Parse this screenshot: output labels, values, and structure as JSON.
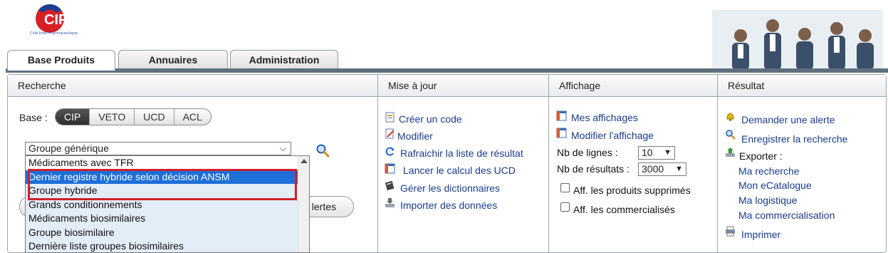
{
  "header": {
    "logo_text": "CIP",
    "logo_subtitle": "Club Inter Pharmaceutique"
  },
  "tabs": [
    {
      "label": "Base Produits",
      "active": true
    },
    {
      "label": "Annuaires",
      "active": false
    },
    {
      "label": "Administration",
      "active": false
    }
  ],
  "recherche": {
    "title": "Recherche",
    "base_label": "Base :",
    "base_options": [
      "CIP",
      "VETO",
      "UCD",
      "ACL"
    ],
    "base_selected": "CIP",
    "select_value": "Groupe générique",
    "dropdown_items": [
      "Médicaments avec TFR",
      "Dernier registre hybride selon décision ANSM",
      "Groupe hybride",
      "Grands conditionnements",
      "Médicaments biosimilaires",
      "Groupe biosimilaire",
      "Dernière liste groupes biosimilaires"
    ],
    "dropdown_highlighted": "Dernier registre hybride selon décision ANSM",
    "hidden_button_label": "lertes"
  },
  "mise_a_jour": {
    "title": "Mise à jour",
    "links": [
      "Créer un code",
      "Modifier",
      "Rafraichir la liste de résultat",
      "Lancer le calcul des UCD",
      "Gérer les dictionnaires",
      "Importer des données"
    ]
  },
  "affichage": {
    "title": "Affichage",
    "links": [
      "Mes affichages",
      "Modifier l'affichage"
    ],
    "nb_lignes_label": "Nb de lignes :",
    "nb_lignes_value": "10",
    "nb_resultats_label": "Nb de résultats :",
    "nb_resultats_value": "3000",
    "checkbox_supprimes": "Aff. les produits supprimés",
    "checkbox_commercialises": "Aff. les commercialisés"
  },
  "resultat": {
    "title": "Résultat",
    "demander_alerte": "Demander une alerte",
    "enregistrer": "Enregistrer la recherche",
    "exporter": "Exporter :",
    "export_links": [
      "Ma recherche",
      "Mon eCatalogue",
      "Ma logistique",
      "Ma commercialisation"
    ],
    "imprimer": "Imprimer"
  },
  "colors": {
    "tab_border": "#8e9aa6",
    "link": "#1a3c8a",
    "highlight": "#1e6fd8",
    "callout": "#d0202a",
    "logo_red": "#d81f26",
    "logo_blue": "#1d3f8f"
  }
}
